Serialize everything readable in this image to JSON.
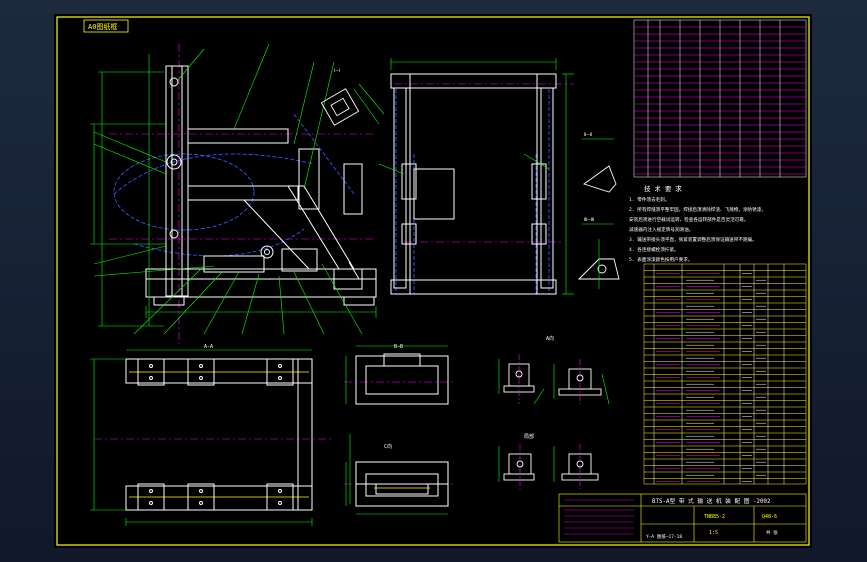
{
  "tag": "A0图纸框",
  "title_block": {
    "drawing_title": "BTS-A型  带 式 输 送 机 装 配 图 -2002",
    "material_code": "TNB85-2",
    "material_code_alt": "Q48-6",
    "scale_label": "1:5",
    "drawing_no": "Y—A 图纸—17·18",
    "sheet_label": "共 张"
  },
  "notes": {
    "title": "技 术 要 求",
    "lines": [
      "1. 零件须去毛刺。",
      "2. 所有焊缝须平整牢固，焊接后须清除焊渣、飞溅物，涂防锈漆。",
      "   安装后须进行空载试运转，检查各运转部件是否灵活可靠。",
      "   减速器内注入规定牌号润滑油。",
      "3. 输送带接头须平直，张紧装置调整后须保证输送带不跑偏。",
      "4. 各连接螺栓须拧紧。",
      "5. 表面涂漆颜色按用户要求。"
    ]
  },
  "view_labels": {
    "top_view": "A-A",
    "side_view": "B-B",
    "detail_a": "A向",
    "detail_b": "C向",
    "section_1": "Ⅰ—Ⅰ",
    "section_2": "Ⅱ—Ⅱ",
    "section_3": "Ⅲ—Ⅲ",
    "detail_c": "局部"
  },
  "colors": {
    "frame": "#ffff00",
    "outline": "#ffffff",
    "centerline": "#ff00ff",
    "dimension": "#00ff00",
    "hidden": "#3355ff",
    "table_text": "#ffffff",
    "annotation": "#ff00ff"
  }
}
